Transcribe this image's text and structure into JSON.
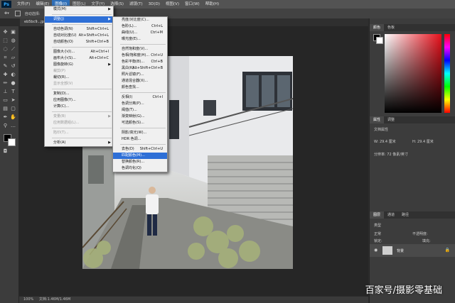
{
  "menubar": {
    "logo": "Ps",
    "items": [
      "文件(F)",
      "编辑(E)",
      "图像(I)",
      "图层(L)",
      "文字(Y)",
      "选择(S)",
      "滤镜(T)",
      "3D(D)",
      "视图(V)",
      "窗口(W)",
      "帮助(H)"
    ],
    "active_index": 2
  },
  "optionsbar": {
    "auto_select": "自动选择:"
  },
  "document_tab": {
    "name": "eb5bc9...jpg @ 100%(RGB/8#)",
    "close": "×"
  },
  "statusbar": {
    "zoom": "100%",
    "doc": "文档:1.46M/1.46M"
  },
  "image_menu": {
    "items": [
      {
        "label": "模式(M)",
        "shortcut": "",
        "arrow": true,
        "disabled": false
      },
      {
        "sep": true
      },
      {
        "label": "调整(J)",
        "shortcut": "",
        "arrow": true,
        "disabled": false,
        "highlight": true
      },
      {
        "sep": true
      },
      {
        "label": "自动色调(N)",
        "shortcut": "Shift+Ctrl+L",
        "disabled": false
      },
      {
        "label": "自动对比度(U)",
        "shortcut": "Alt+Shift+Ctrl+L",
        "disabled": false
      },
      {
        "label": "自动颜色(O)",
        "shortcut": "Shift+Ctrl+B",
        "disabled": false
      },
      {
        "sep": true
      },
      {
        "label": "图像大小(I)...",
        "shortcut": "Alt+Ctrl+I",
        "disabled": false
      },
      {
        "label": "画布大小(S)...",
        "shortcut": "Alt+Ctrl+C",
        "disabled": false
      },
      {
        "label": "图像旋转(G)",
        "shortcut": "",
        "arrow": true,
        "disabled": false
      },
      {
        "label": "裁剪(P)",
        "shortcut": "",
        "disabled": true
      },
      {
        "label": "裁切(R)...",
        "shortcut": "",
        "disabled": false
      },
      {
        "label": "显示全部(V)",
        "shortcut": "",
        "disabled": true
      },
      {
        "sep": true
      },
      {
        "label": "复制(D)...",
        "shortcut": "",
        "disabled": false
      },
      {
        "label": "应用图像(Y)...",
        "shortcut": "",
        "disabled": false
      },
      {
        "label": "计算(C)...",
        "shortcut": "",
        "disabled": false
      },
      {
        "sep": true
      },
      {
        "label": "变量(B)",
        "shortcut": "",
        "arrow": true,
        "disabled": true
      },
      {
        "label": "应用数据组(L)...",
        "shortcut": "",
        "disabled": true
      },
      {
        "sep": true
      },
      {
        "label": "陷印(T)...",
        "shortcut": "",
        "disabled": true
      },
      {
        "sep": true
      },
      {
        "label": "分析(A)",
        "shortcut": "",
        "arrow": true,
        "disabled": false
      }
    ]
  },
  "adjust_menu": {
    "items": [
      {
        "label": "亮度/对比度(C)...",
        "shortcut": ""
      },
      {
        "label": "色阶(L)...",
        "shortcut": "Ctrl+L"
      },
      {
        "label": "曲线(U)...",
        "shortcut": "Ctrl+M"
      },
      {
        "label": "曝光度(E)...",
        "shortcut": ""
      },
      {
        "sep": true
      },
      {
        "label": "自然饱和度(V)...",
        "shortcut": ""
      },
      {
        "label": "色相/饱和度(H)...",
        "shortcut": "Ctrl+U"
      },
      {
        "label": "色彩平衡(B)...",
        "shortcut": "Ctrl+B"
      },
      {
        "label": "黑白(K)...",
        "shortcut": "Alt+Shift+Ctrl+B"
      },
      {
        "label": "照片滤镜(F)...",
        "shortcut": ""
      },
      {
        "label": "通道混合器(X)...",
        "shortcut": ""
      },
      {
        "label": "颜色查找...",
        "shortcut": ""
      },
      {
        "sep": true
      },
      {
        "label": "反相(I)",
        "shortcut": "Ctrl+I"
      },
      {
        "label": "色调分离(P)...",
        "shortcut": ""
      },
      {
        "label": "阈值(T)...",
        "shortcut": ""
      },
      {
        "label": "渐变映射(G)...",
        "shortcut": ""
      },
      {
        "label": "可选颜色(S)...",
        "shortcut": ""
      },
      {
        "sep": true
      },
      {
        "label": "阴影/高光(W)...",
        "shortcut": ""
      },
      {
        "label": "HDR 色调...",
        "shortcut": ""
      },
      {
        "sep": true
      },
      {
        "label": "去色(D)",
        "shortcut": "Shift+Ctrl+U"
      },
      {
        "label": "匹配颜色(M)...",
        "shortcut": "",
        "highlight": true
      },
      {
        "label": "替换颜色(R)...",
        "shortcut": ""
      },
      {
        "label": "色调均化(Q)",
        "shortcut": ""
      }
    ]
  },
  "color_panel": {
    "tabs": [
      "颜色",
      "色板"
    ]
  },
  "properties_panel": {
    "tabs": [
      "属性",
      "调整"
    ],
    "title": "文档属性",
    "w_label": "W:",
    "w_value": "29.4 厘米",
    "h_label": "H:",
    "h_value": "29.4 厘米",
    "res": "分辨率: 72 像素/英寸"
  },
  "layers_panel": {
    "tabs": [
      "图层",
      "通道",
      "路径"
    ],
    "kind": "类型",
    "blend": "正常",
    "opacity": "不透明度:",
    "lock": "锁定:",
    "fill": "填充:",
    "layer_name": "背景"
  },
  "watermark": "百家号/摄影零基础",
  "colors": {
    "accent": "#2e6fd6",
    "hue_red": "#e8101b"
  }
}
